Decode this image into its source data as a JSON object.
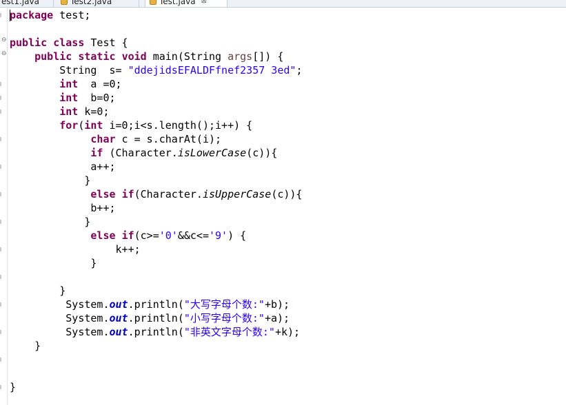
{
  "tabs": [
    {
      "label": "est1.java",
      "active": false
    },
    {
      "label": "Test2.java",
      "active": false
    },
    {
      "label": "Test.java",
      "active": true,
      "close": "⊠"
    }
  ],
  "code": {
    "l1": {
      "kw": "package",
      "rest": " test;"
    },
    "l3": {
      "kw1": "public",
      "kw2": "class",
      "rest": " Test {"
    },
    "l4": {
      "indent": "    ",
      "kw1": "public",
      "kw2": "static",
      "kw3": "void",
      "name": " main(String ",
      "param": "args",
      "rest": "[]) {"
    },
    "l5": {
      "text": "        String  s= ",
      "str": "\"ddejidsEFALDFfnef2357 3ed\"",
      "end": ";"
    },
    "l6": {
      "indent": "        ",
      "kw": "int",
      "rest": "  a =0;"
    },
    "l7": {
      "indent": "        ",
      "kw": "int",
      "rest": "  b=0;"
    },
    "l8": {
      "indent": "        ",
      "kw": "int",
      "rest": " k=0;"
    },
    "l9": {
      "indent": "        ",
      "kw": "for",
      "p1": "(",
      "kw2": "int",
      "rest": " i=0;i<s.length();i++) {"
    },
    "l10": {
      "indent": "             ",
      "kw": "char",
      "rest": " c = s.charAt(i);"
    },
    "l11": {
      "indent": "             ",
      "kw": "if",
      "a": " (Character.",
      "method": "isLowerCase",
      "b": "(c)){"
    },
    "l12": {
      "indent": "             ",
      "text": "a++;"
    },
    "l13": {
      "indent": "            ",
      "text": "}"
    },
    "l14": {
      "indent": "             ",
      "kw1": "else",
      "kw2": "if",
      "a": "(Character.",
      "method": "isUpperCase",
      "b": "(c)){"
    },
    "l15": {
      "indent": "             ",
      "text": "b++;"
    },
    "l16": {
      "indent": "            ",
      "text": "}"
    },
    "l17": {
      "indent": "             ",
      "kw1": "else",
      "kw2": "if",
      "a": "(c>=",
      "s1": "'0'",
      "b": "&&c<=",
      "s2": "'9'",
      "c": ") {"
    },
    "l18": {
      "indent": "                 ",
      "text": "k++;"
    },
    "l19": {
      "indent": "             ",
      "text": "}"
    },
    "l21": {
      "indent": "        ",
      "text": "}"
    },
    "l22": {
      "indent": "         ",
      "a": "System.",
      "field": "out",
      "b": ".println(",
      "str": "\"大写字母个数:\"",
      "c": "+b);"
    },
    "l23": {
      "indent": "         ",
      "a": "System.",
      "field": "out",
      "b": ".println(",
      "str": "\"小写字母个数:\"",
      "c": "+a);"
    },
    "l24": {
      "indent": "         ",
      "a": "System.",
      "field": "out",
      "b": ".println(",
      "str": "\"非英文字母个数:\"",
      "c": "+k);"
    },
    "l25": {
      "indent": "    ",
      "text": "}"
    },
    "l28": {
      "text": "}"
    }
  }
}
